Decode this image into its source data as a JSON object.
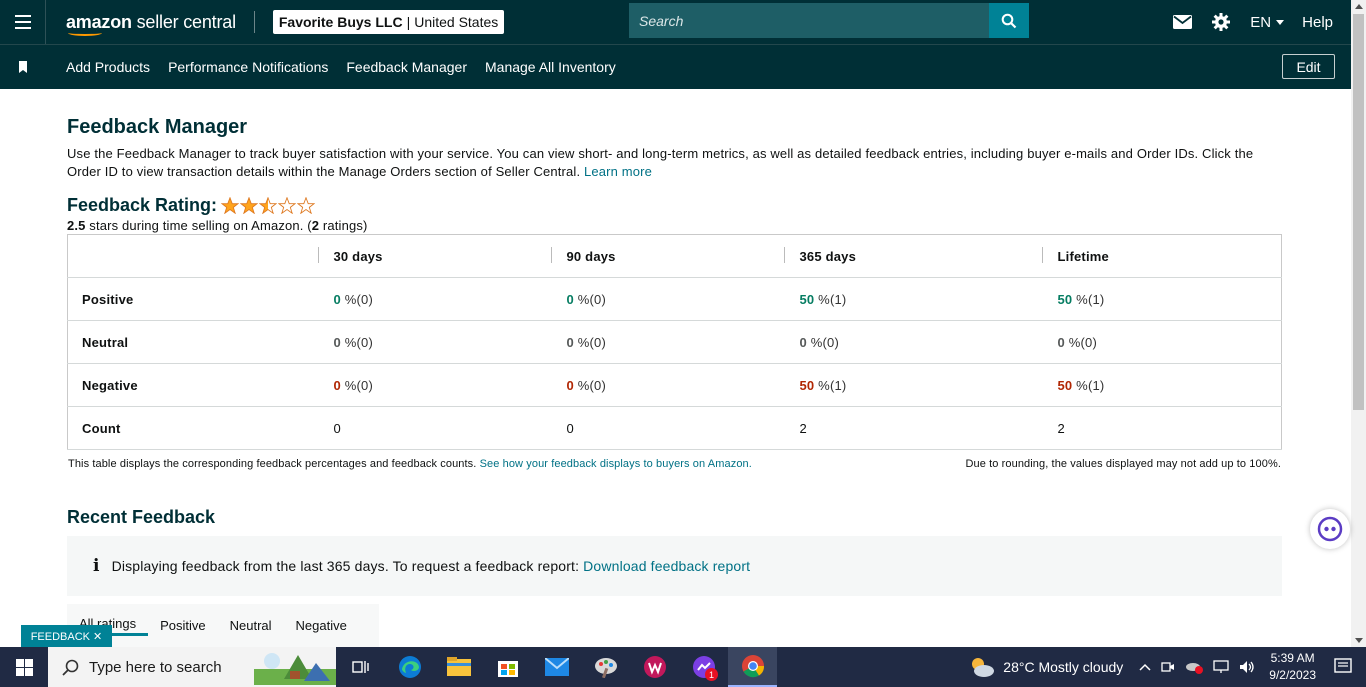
{
  "header": {
    "logo": {
      "brand": "amazon",
      "product": " seller central"
    },
    "account": {
      "name": "Favorite Buys LLC",
      "region": "United States"
    },
    "search_placeholder": "Search",
    "language": "EN",
    "help": "Help"
  },
  "nav": {
    "items": [
      "Add Products",
      "Performance Notifications",
      "Feedback Manager",
      "Manage All Inventory"
    ],
    "edit": "Edit"
  },
  "page": {
    "title": "Feedback Manager",
    "description": "Use the Feedback Manager to track buyer satisfaction with your service. You can view short- and long-term metrics, as well as detailed feedback entries, including buyer e-mails and Order IDs. Click the Order ID to view transaction details within the Manage Orders section of Seller Central.",
    "learn_more": "Learn more",
    "rating_label": "Feedback Rating:",
    "rating_stars": 2.5,
    "rating_value": "2.5",
    "rating_text_mid": " stars during time selling on Amazon. (",
    "rating_count": "2",
    "rating_text_end": " ratings)"
  },
  "table": {
    "columns": [
      "30 days",
      "90 days",
      "365 days",
      "Lifetime"
    ],
    "rows": [
      {
        "label": "Positive",
        "cells": [
          {
            "v": "0",
            "p": " %(0)"
          },
          {
            "v": "0",
            "p": " %(0)"
          },
          {
            "v": "50",
            "p": " %(1)"
          },
          {
            "v": "50",
            "p": " %(1)"
          }
        ]
      },
      {
        "label": "Neutral",
        "cells": [
          {
            "v": "0",
            "p": " %(0)"
          },
          {
            "v": "0",
            "p": " %(0)"
          },
          {
            "v": "0",
            "p": " %(0)"
          },
          {
            "v": "0",
            "p": " %(0)"
          }
        ]
      },
      {
        "label": "Negative",
        "cells": [
          {
            "v": "0",
            "p": " %(0)"
          },
          {
            "v": "0",
            "p": " %(0)"
          },
          {
            "v": "50",
            "p": " %(1)"
          },
          {
            "v": "50",
            "p": " %(1)"
          }
        ]
      },
      {
        "label": "Count",
        "cells": [
          {
            "v": "0"
          },
          {
            "v": "0"
          },
          {
            "v": "2"
          },
          {
            "v": "2"
          }
        ]
      }
    ],
    "note_left": "This table displays the corresponding feedback percentages and feedback counts.",
    "note_link": "See how your feedback displays to buyers on Amazon.",
    "note_right": "Due to rounding, the values displayed may not add up to 100%."
  },
  "recent": {
    "title": "Recent Feedback",
    "info_icon": "i",
    "info_text": "Displaying feedback from the last 365 days. To request a feedback report:",
    "info_link": "Download feedback report",
    "tabs": [
      "All ratings",
      "Positive",
      "Neutral",
      "Negative"
    ],
    "active_tab": "All ratings"
  },
  "feedback_tab": "FEEDBACK ✕",
  "taskbar": {
    "search_placeholder": "Type here to search",
    "weather": "28°C  Mostly cloudy",
    "time": "5:39 AM",
    "date": "9/2/2023",
    "notification_count": "1",
    "apps": [
      "task-view-icon",
      "edge-icon",
      "file-explorer-icon",
      "store-icon",
      "mail-icon",
      "paint-icon",
      "wps-icon",
      "messenger-icon",
      "chrome-icon"
    ]
  },
  "colors": {
    "header_bg": "#002f36",
    "accent": "#008296",
    "positive": "#067d62",
    "negative": "#b12704",
    "star": "#ffa41c"
  }
}
